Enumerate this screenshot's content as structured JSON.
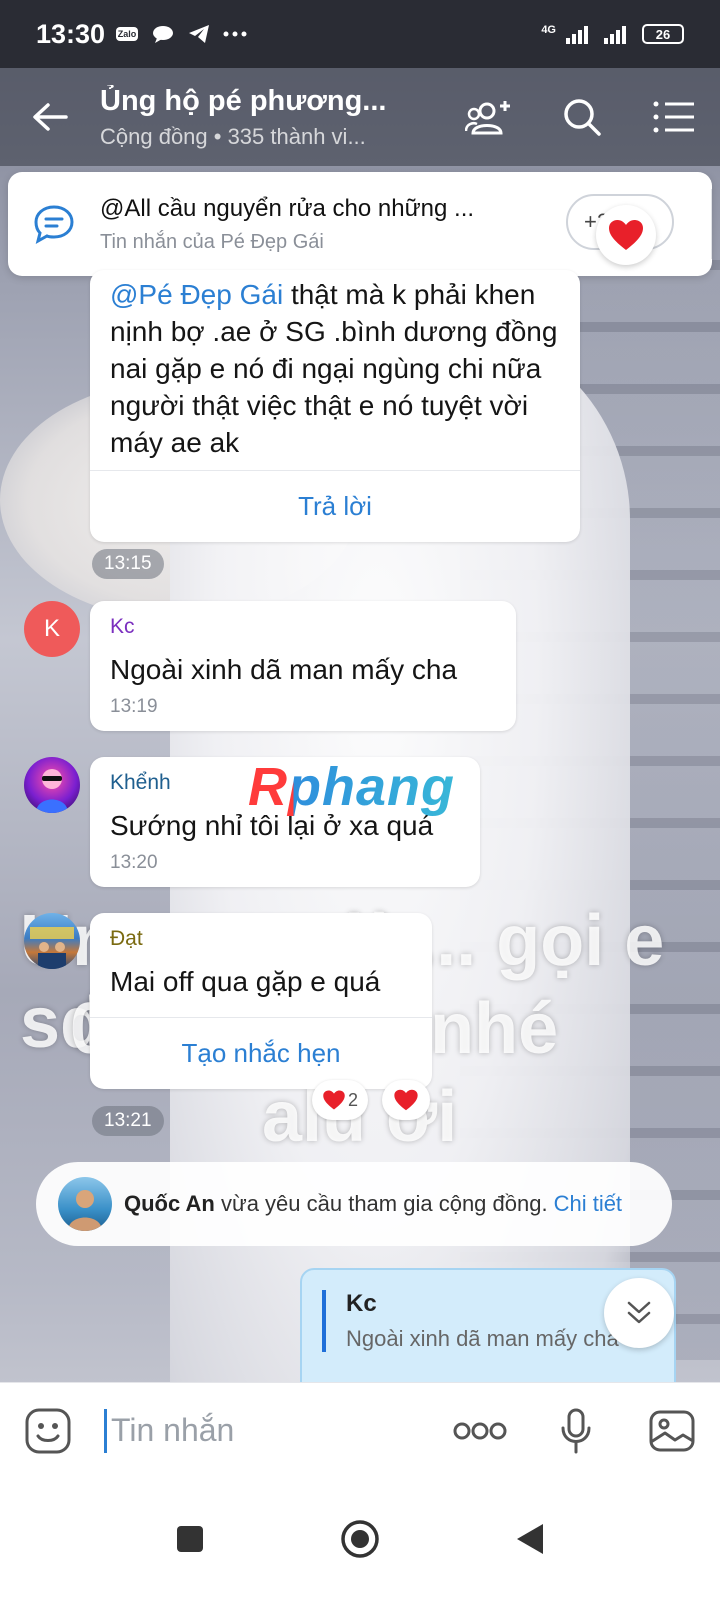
{
  "status_bar": {
    "time": "13:30",
    "app_badge": "Zalo",
    "network": "4G",
    "battery": "26"
  },
  "header": {
    "title": "Ủng hộ pé phương...",
    "subtitle": "Cộng đồng • 335 thành vi..."
  },
  "pinned": {
    "title": "@All cầu nguyển rửa cho những ...",
    "subtitle": "Tin nhắn của Pé Đẹp Gái",
    "more_label": "+2"
  },
  "messages": [
    {
      "mention": "@Pé Đẹp Gái",
      "text": " thật mà k  phải khen nịnh bợ .ae ở SG .bình dương đồng nai gặp e nó đi ngại ngùng chi nữa người thật việc thật e nó tuyệt vời máy ae ak",
      "action": "Trả lời"
    },
    {
      "sender": "Kc",
      "avatar_letter": "K",
      "text": "Ngoài xinh dã man mấy cha",
      "time": "13:19",
      "sender_color": "#7b2fbf"
    },
    {
      "sender": "Khểnh",
      "text": "Sướng nhỉ tôi lại ở xa quá",
      "time": "13:20",
      "sender_color": "#1f5f8f"
    },
    {
      "sender": "Đạt",
      "text": "Mai off qua gặp e quá",
      "action": "Tạo nhắc hẹn",
      "sender_color": "#7a6a10",
      "reaction_count": "2"
    }
  ],
  "time_chips": [
    "13:15",
    "13:21"
  ],
  "background_text": [
    "Ummm... lừ... gọi e sdt",
    "0...........30 nhé",
    "alu ơi"
  ],
  "watermark": "Rphang",
  "system_message": {
    "name": "Quốc An",
    "text": " vừa yêu cầu tham gia cộng đồng.",
    "link": "Chi tiết"
  },
  "reply_preview": {
    "name": "Kc",
    "text": "Ngoài xinh dã man mấy cha"
  },
  "composer": {
    "placeholder": "Tin nhắn"
  },
  "colors": {
    "accent": "#2b7fd3",
    "heart": "#e8202a"
  }
}
